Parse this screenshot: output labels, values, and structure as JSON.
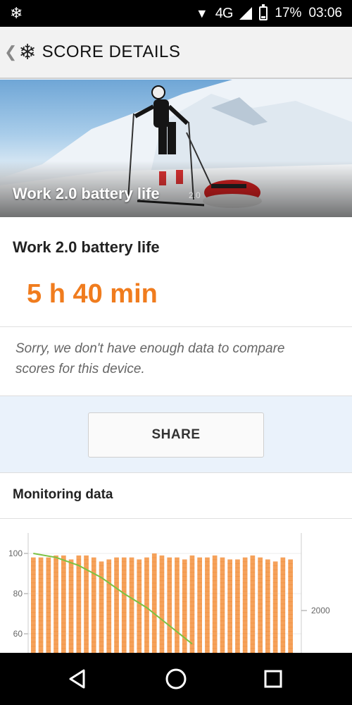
{
  "status_bar": {
    "network": "4G",
    "battery_percent": "17%",
    "battery_level": 0.17,
    "time": "03:06",
    "notification_icon": "snowflake-icon"
  },
  "app_bar": {
    "back_icon": "chevron-left-icon",
    "logo_icon": "snowflake-icon",
    "title": "SCORE DETAILS"
  },
  "hero": {
    "title": "Work 2.0 battery life",
    "version": "2.0"
  },
  "score": {
    "name": "Work 2.0 battery life",
    "value": "5 h 40 min",
    "note": "Sorry, we don't have enough data to compare scores for this device.",
    "value_color": "#f07c1e"
  },
  "share": {
    "label": "SHARE"
  },
  "monitoring": {
    "title": "Monitoring data"
  },
  "chart_data": {
    "type": "bar",
    "left_axis": {
      "ticks": [
        "100",
        "80",
        "60"
      ],
      "tick_values": [
        100,
        80,
        60
      ]
    },
    "right_axis": {
      "ticks": [
        "2000"
      ],
      "tick_values": [
        2000
      ]
    },
    "ylim_left": [
      50,
      102
    ],
    "bar_values": [
      98,
      98,
      98,
      99,
      99,
      97,
      99,
      99,
      98,
      96,
      97,
      98,
      98,
      98,
      97,
      98,
      100,
      99,
      98,
      98,
      97,
      99,
      98,
      98,
      99,
      98,
      97,
      97,
      98,
      99,
      98,
      97,
      96,
      98,
      97
    ],
    "battery_line": {
      "x": [
        0,
        3,
        6,
        9,
        12,
        15,
        18,
        21
      ],
      "y": [
        100,
        98,
        94,
        88,
        80,
        73,
        64,
        55
      ]
    },
    "bar_color": "#f5a15a",
    "line_color": "#7cc242"
  },
  "nav_bar": {
    "back_icon": "triangle-back-icon",
    "home_icon": "circle-home-icon",
    "recent_icon": "square-recents-icon"
  }
}
